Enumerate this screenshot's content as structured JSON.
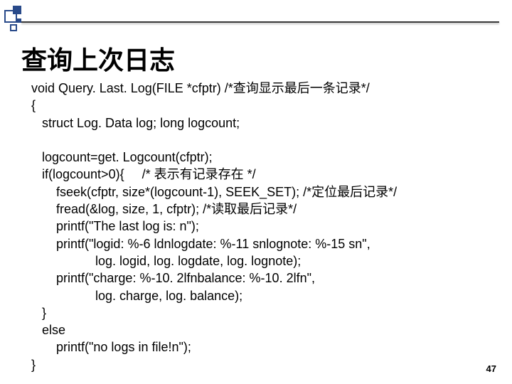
{
  "slide": {
    "title": "查询上次日志",
    "page_number": "47"
  },
  "code": {
    "l01": "void Query. Last. Log(FILE *cfptr) /*查询显示最后一条记录*/",
    "l02": "{",
    "l03": "   struct Log. Data log; long logcount;",
    "l04": "",
    "l05": "   logcount=get. Logcount(cfptr);",
    "l06": "   if(logcount>0){     /* 表示有记录存在 */",
    "l07": "       fseek(cfptr, size*(logcount-1), SEEK_SET); /*定位最后记录*/",
    "l08": "       fread(&log, size, 1, cfptr); /*读取最后记录*/",
    "l09": "       printf(\"The last log is: n\");",
    "l10": "       printf(\"logid: %-6 ldnlogdate: %-11 snlognote: %-15 sn\",",
    "l11": "                  log. logid, log. logdate, log. lognote);",
    "l12": "       printf(\"charge: %-10. 2lfnbalance: %-10. 2lfn\",",
    "l13": "                  log. charge, log. balance);",
    "l14": "   }",
    "l15": "   else",
    "l16": "       printf(\"no logs in file!n\");",
    "l17": "}"
  }
}
